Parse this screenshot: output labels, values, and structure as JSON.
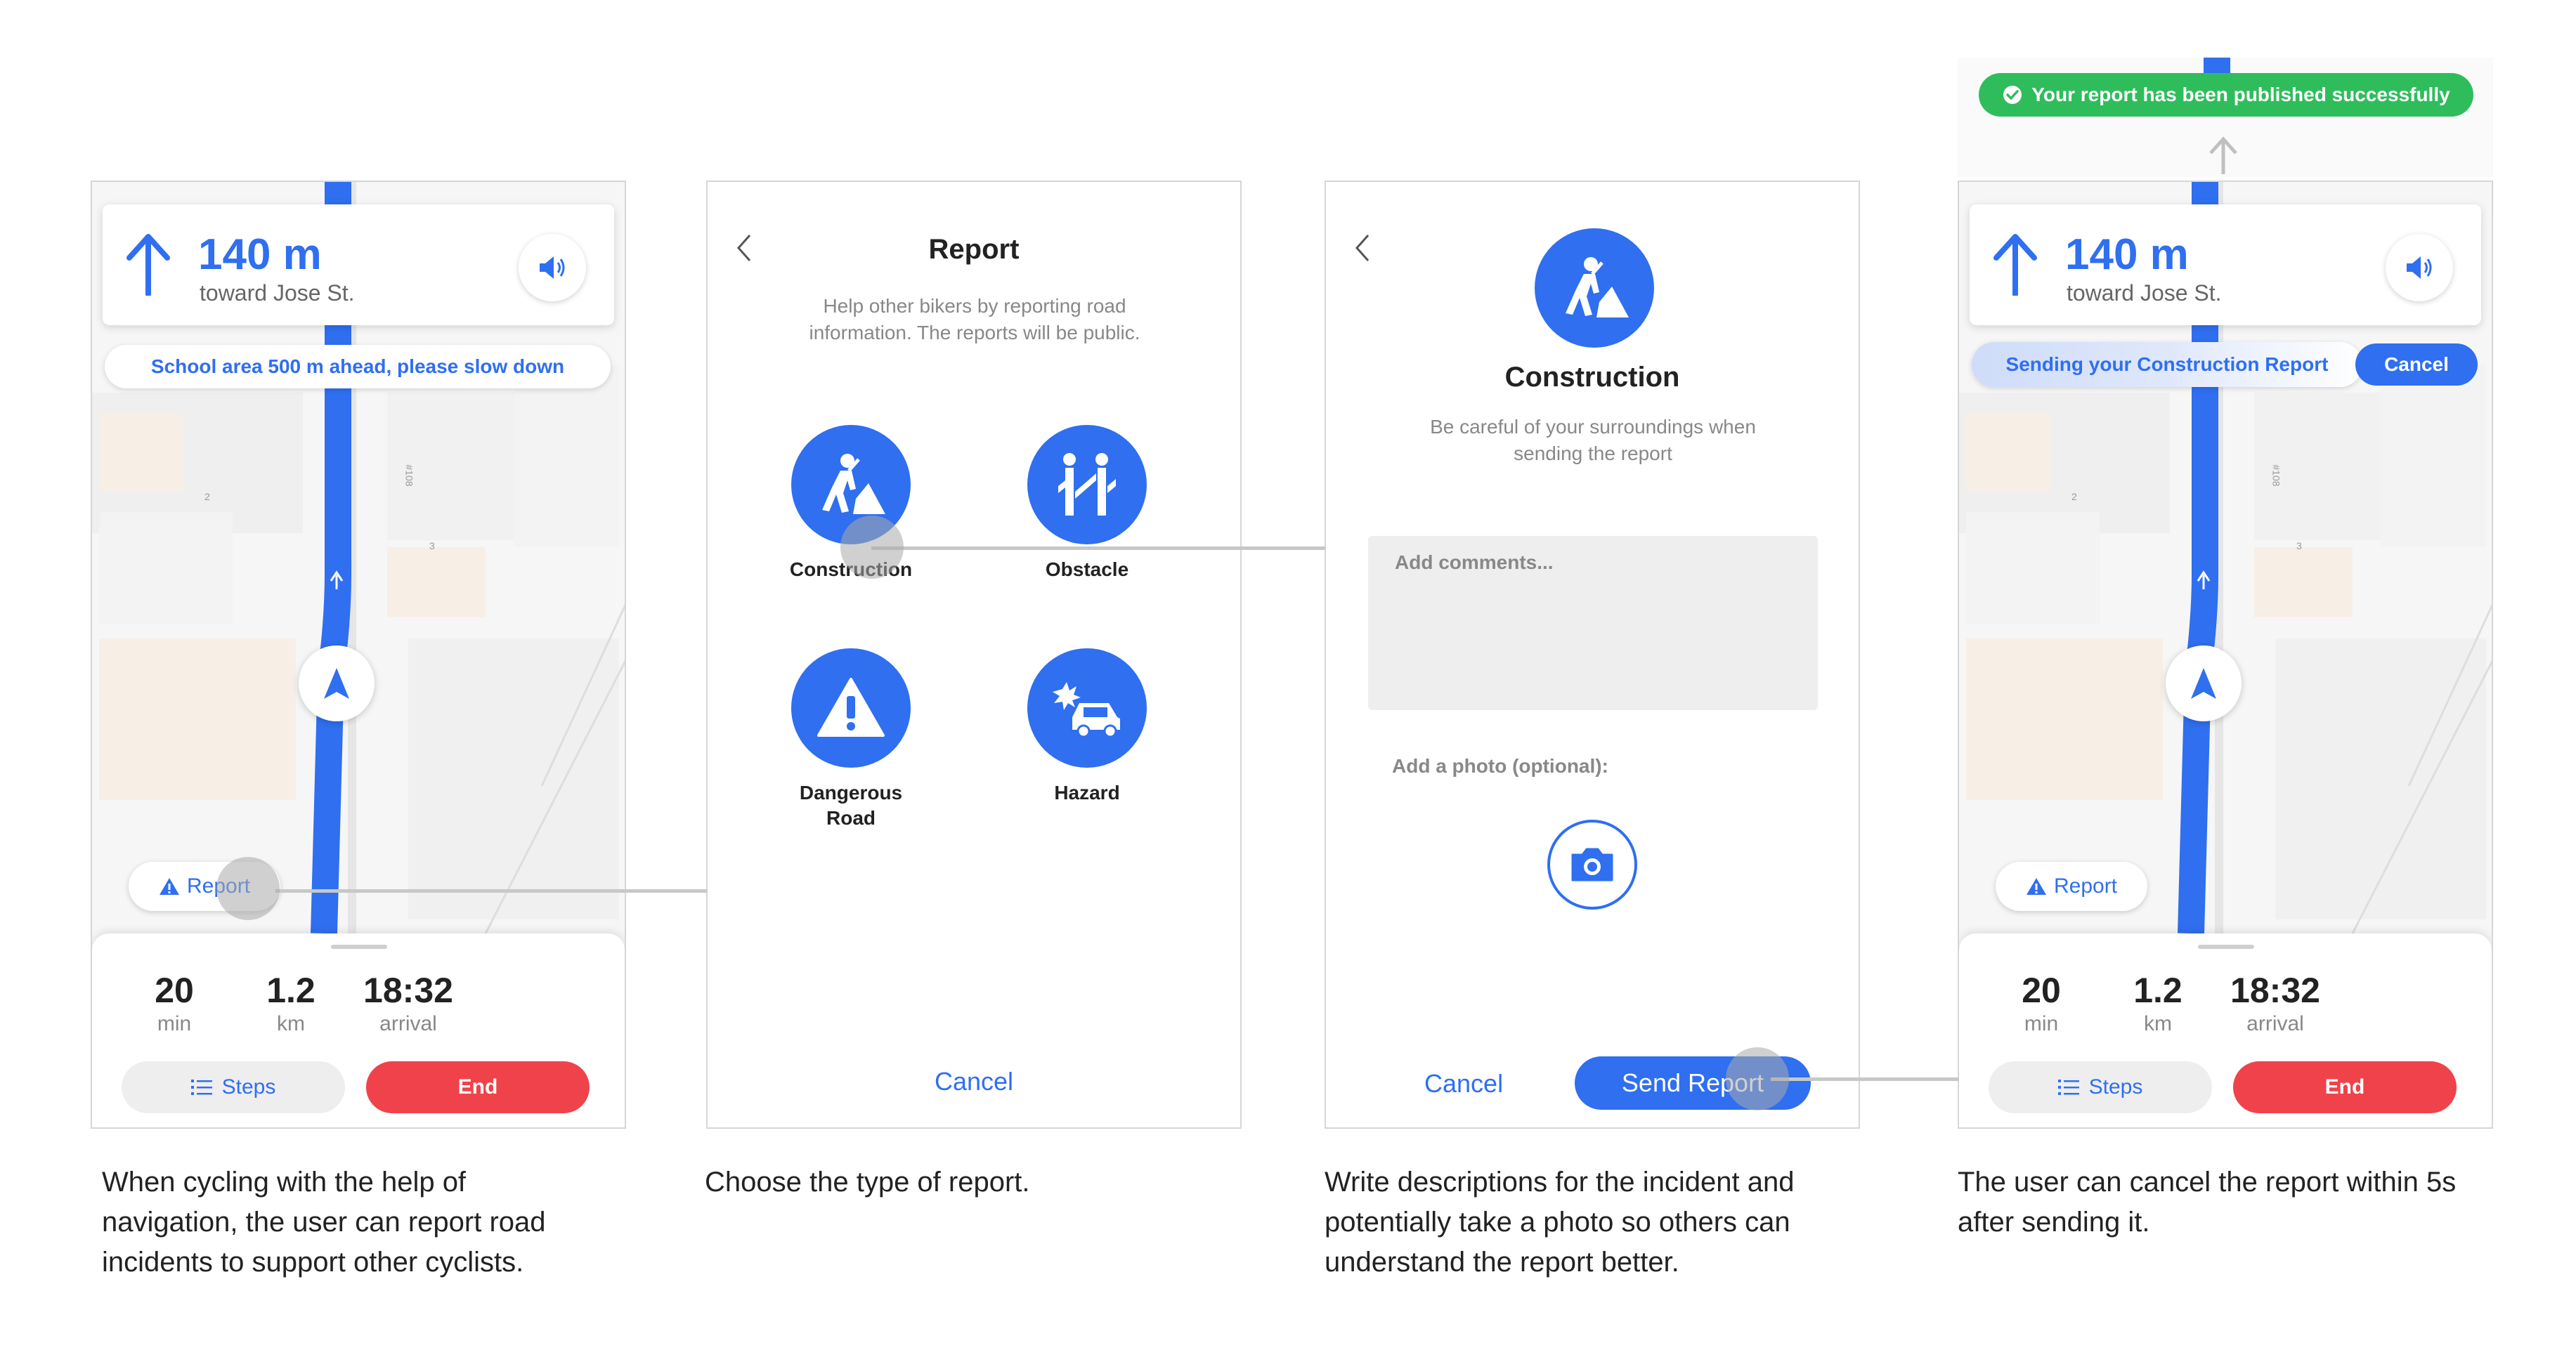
{
  "colors": {
    "primary": "#2f6ff0",
    "danger": "#f0424a",
    "success": "#2fbd5c",
    "route": "#2f6ff0"
  },
  "navigation": {
    "distance": "140 m",
    "toward": "toward Jose St.",
    "alert": "School area 500 m ahead, please slow down",
    "report_button": "Report",
    "stats": [
      {
        "value": "20",
        "unit": "min"
      },
      {
        "value": "1.2",
        "unit": "km"
      },
      {
        "value": "18:32",
        "unit": "arrival"
      }
    ],
    "steps_button": "Steps",
    "end_button": "End",
    "sending_text": "Sending your Construction Report",
    "cancel_button": "Cancel",
    "toast": "Your report has been published successfully"
  },
  "report_screen": {
    "title": "Report",
    "subtitle": "Help other bikers by reporting road information. The reports will be public.",
    "types": [
      {
        "label": "Construction",
        "icon": "construction-icon"
      },
      {
        "label": "Obstacle",
        "icon": "obstacle-icon"
      },
      {
        "label": "Dangerous Road",
        "icon": "warning-icon"
      },
      {
        "label": "Hazard",
        "icon": "car-crash-icon"
      }
    ],
    "cancel": "Cancel"
  },
  "detail_screen": {
    "title": "Construction",
    "subtitle": "Be careful of your surroundings when sending the report",
    "comment_placeholder": "Add comments...",
    "photo_label": "Add a photo (optional):",
    "cancel": "Cancel",
    "send": "Send Report"
  },
  "map_labels": {
    "street_num": "#108",
    "num_a": "3",
    "num_b": "2"
  },
  "captions": [
    "When cycling with the help of navigation, the user can report road incidents to support other cyclists.",
    "Choose the type of report.",
    "Write descriptions for the incident and potentially take a photo so others can understand the report better.",
    "The user can cancel the report within 5s after sending it."
  ]
}
